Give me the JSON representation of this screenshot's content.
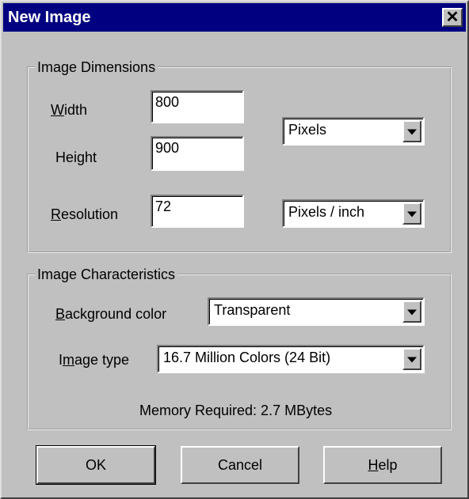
{
  "window": {
    "title": "New Image",
    "close_glyph": "✕"
  },
  "dimensions": {
    "group_title": "Image Dimensions",
    "width_label_prefix": "",
    "width_label_accel": "W",
    "width_label_rest": "idth",
    "height_label_pre": "Hei",
    "height_label_accel": "g",
    "height_label_rest": "ht",
    "resolution_label_accel": "R",
    "resolution_label_rest": "esolution",
    "width_value": "800",
    "height_value": "900",
    "resolution_value": "72",
    "size_unit": "Pixels",
    "resolution_unit": "Pixels / inch"
  },
  "characteristics": {
    "group_title": "Image Characteristics",
    "bg_label_accel": "B",
    "bg_label_rest": "ackground color",
    "bg_value": "Transparent",
    "type_label_pre": "I",
    "type_label_accel": "m",
    "type_label_rest": "age type",
    "type_value": "16.7 Million Colors (24 Bit)",
    "memory": "Memory Required: 2.7 MBytes"
  },
  "buttons": {
    "ok": "OK",
    "cancel": "Cancel",
    "help_accel": "H",
    "help_rest": "elp"
  },
  "colors": {
    "titlebar": "#000080",
    "face": "#c0c0c0"
  },
  "icons": {
    "dropdown": "chevron-down-icon",
    "close": "close-icon"
  }
}
